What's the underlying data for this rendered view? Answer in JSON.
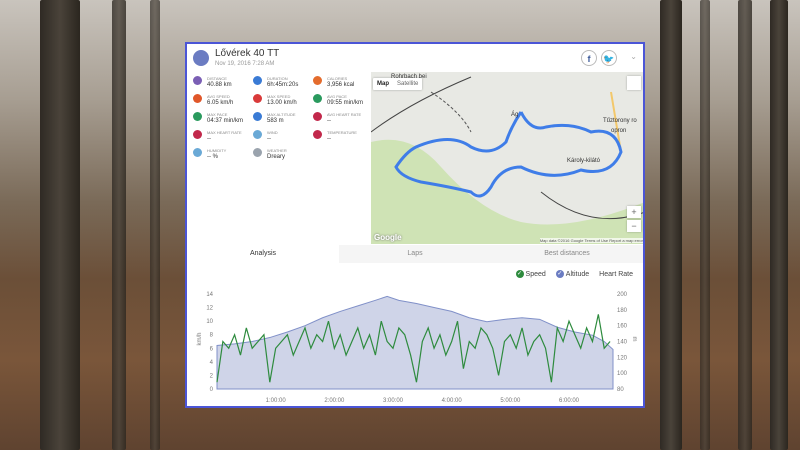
{
  "header": {
    "title": "Lővérek 40 TT",
    "subtitle": "Nov 19, 2016 7:28 AM"
  },
  "stats": [
    {
      "label": "Distance",
      "value": "40.88 km",
      "icon": "route-icon",
      "color": "#7b5fb5"
    },
    {
      "label": "Duration",
      "value": "6h:45m:20s",
      "icon": "clock-icon",
      "color": "#3a7bd5"
    },
    {
      "label": "Calories",
      "value": "3,956 kcal",
      "icon": "flame-icon",
      "color": "#e46c2d"
    },
    {
      "label": "Avg speed",
      "value": "6.05 km/h",
      "icon": "speedometer-icon",
      "color": "#e0572a"
    },
    {
      "label": "Max speed",
      "value": "13.00 km/h",
      "icon": "speedometer-icon",
      "color": "#d93a3a"
    },
    {
      "label": "Avg pace",
      "value": "09:55 min/km",
      "icon": "pace-icon",
      "color": "#2a9a5e"
    },
    {
      "label": "Max pace",
      "value": "04:37 min/km",
      "icon": "pace-icon",
      "color": "#2a9a5e"
    },
    {
      "label": "Max altitude",
      "value": "583 m",
      "icon": "mountain-icon",
      "color": "#3a7bd5"
    },
    {
      "label": "Avg heart rate",
      "value": "--",
      "icon": "heart-icon",
      "color": "#c2284b"
    },
    {
      "label": "Max heart rate",
      "value": "--",
      "icon": "heart-icon",
      "color": "#c2284b"
    },
    {
      "label": "Wind",
      "value": "--",
      "icon": "wind-icon",
      "color": "#6aa9d6"
    },
    {
      "label": "Temperature",
      "value": "--",
      "icon": "thermometer-icon",
      "color": "#c2284b"
    },
    {
      "label": "Humidity",
      "value": "-- %",
      "icon": "droplets-icon",
      "color": "#6aa9d6"
    },
    {
      "label": "Weather",
      "value": "Dreary",
      "icon": "cloud-icon",
      "color": "#9aa3ad"
    }
  ],
  "map": {
    "tab_map": "Map",
    "tab_satellite": "Satellite",
    "labels": [
      "Rohrbach bei",
      "Tűztorony ro",
      "opron",
      "Károly-kilátó",
      "Ág"
    ],
    "google": "Google",
    "footer": "Map data ©2016 Google   Terms of Use   Report a map error",
    "zoom_in": "+",
    "zoom_out": "−"
  },
  "tabs": [
    "Analysis",
    "Laps",
    "Best distances"
  ],
  "legend": {
    "speed": "Speed",
    "altitude": "Altitude",
    "heart_rate": "Heart Rate"
  },
  "colors": {
    "speed": "#2e8b3e",
    "altitude": "#8090c8",
    "altitude_fill": "#cfd4e8",
    "accent": "#4b55d6"
  },
  "chart_data": {
    "type": "line",
    "x_ticks": [
      "1:00:00",
      "2:00:00",
      "3:00:00",
      "4:00:00",
      "5:00:00",
      "6:00:00"
    ],
    "xlim": [
      0,
      6.75
    ],
    "ylabel_left": "km/h",
    "ylabel_right": "m",
    "y_left_ticks": [
      "0",
      "2",
      "4",
      "6",
      "8",
      "10",
      "12",
      "14"
    ],
    "y_right_ticks": [
      "80",
      "100",
      "120",
      "140",
      "160",
      "180",
      "200"
    ],
    "ylim_left": [
      0,
      14
    ],
    "ylim_right": [
      80,
      200
    ],
    "altitude": {
      "x": [
        0,
        0.3,
        0.6,
        0.9,
        1.2,
        1.5,
        1.8,
        2.1,
        2.4,
        2.7,
        2.9,
        3.1,
        3.4,
        3.7,
        4.0,
        4.3,
        4.6,
        4.9,
        5.2,
        5.5,
        5.8,
        6.1,
        6.4,
        6.6,
        6.75
      ],
      "values": [
        135,
        137,
        140,
        145,
        152,
        160,
        170,
        178,
        185,
        192,
        197,
        192,
        188,
        183,
        178,
        170,
        165,
        168,
        170,
        168,
        158,
        152,
        148,
        140,
        130
      ]
    },
    "speed": {
      "x": [
        0,
        0.1,
        0.2,
        0.3,
        0.4,
        0.5,
        0.6,
        0.7,
        0.8,
        0.9,
        1.0,
        1.1,
        1.2,
        1.3,
        1.4,
        1.5,
        1.6,
        1.7,
        1.8,
        1.9,
        2.0,
        2.1,
        2.2,
        2.3,
        2.4,
        2.5,
        2.6,
        2.7,
        2.8,
        2.9,
        3.0,
        3.1,
        3.2,
        3.3,
        3.4,
        3.5,
        3.6,
        3.7,
        3.8,
        3.9,
        4.0,
        4.1,
        4.2,
        4.3,
        4.4,
        4.5,
        4.6,
        4.7,
        4.8,
        4.9,
        5.0,
        5.1,
        5.2,
        5.3,
        5.4,
        5.5,
        5.6,
        5.7,
        5.8,
        5.9,
        6.0,
        6.1,
        6.2,
        6.3,
        6.4,
        6.5,
        6.6,
        6.7
      ],
      "values": [
        1,
        7,
        6,
        8,
        5,
        9,
        6,
        7,
        8,
        1,
        6,
        7,
        8,
        5,
        7,
        9,
        6,
        8,
        7,
        10,
        6,
        8,
        5,
        7,
        9,
        6,
        8,
        5,
        10,
        7,
        6,
        9,
        8,
        5,
        1,
        7,
        9,
        6,
        8,
        5,
        7,
        10,
        3,
        7,
        6,
        9,
        8,
        6,
        2,
        7,
        8,
        6,
        9,
        5,
        7,
        8,
        6,
        1,
        9,
        7,
        10,
        8,
        6,
        9,
        7,
        11,
        6,
        7
      ]
    }
  }
}
